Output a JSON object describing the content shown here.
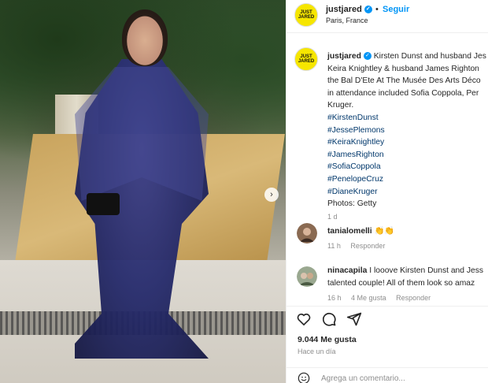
{
  "post": {
    "username": "justjared",
    "follow_label": "Seguir",
    "location": "Paris, France",
    "logo_text": "JUST JARED"
  },
  "caption": {
    "username": "justjared",
    "lines": [
      "Kirsten Dunst and husband Jes",
      "Keira Knightley & husband James Righton",
      "the Bal D'Ete At The Musée Des Arts Déco",
      "in attendance included Sofia Coppola, Per",
      "Kruger."
    ],
    "hashtags": [
      "#KirstenDunst",
      "#JessePlemons",
      "#KeiraKnightley",
      "#JamesRighton",
      "#SofiaCoppola",
      "#PenelopeCruz",
      "#DianeKruger"
    ],
    "credit": "Photos: Getty",
    "time": "1 d"
  },
  "comments": [
    {
      "username": "tanialomelli",
      "text": "👏👏",
      "time": "11 h",
      "reply_label": "Responder",
      "likes_label": ""
    },
    {
      "username": "ninacapila",
      "text": "I looove Kirsten Dunst and Jess",
      "text2": "talented couple! All of them look so amaz",
      "time": "16 h",
      "likes_label": "4 Me gusta",
      "reply_label": "Responder"
    }
  ],
  "footer": {
    "likes": "9.044 Me gusta",
    "ago": "Hace un día",
    "add_comment_placeholder": "Agrega un comentario..."
  },
  "colors": {
    "accent": "#0095f6",
    "hashtag": "#00376b",
    "brand_yellow": "#f6e600"
  }
}
